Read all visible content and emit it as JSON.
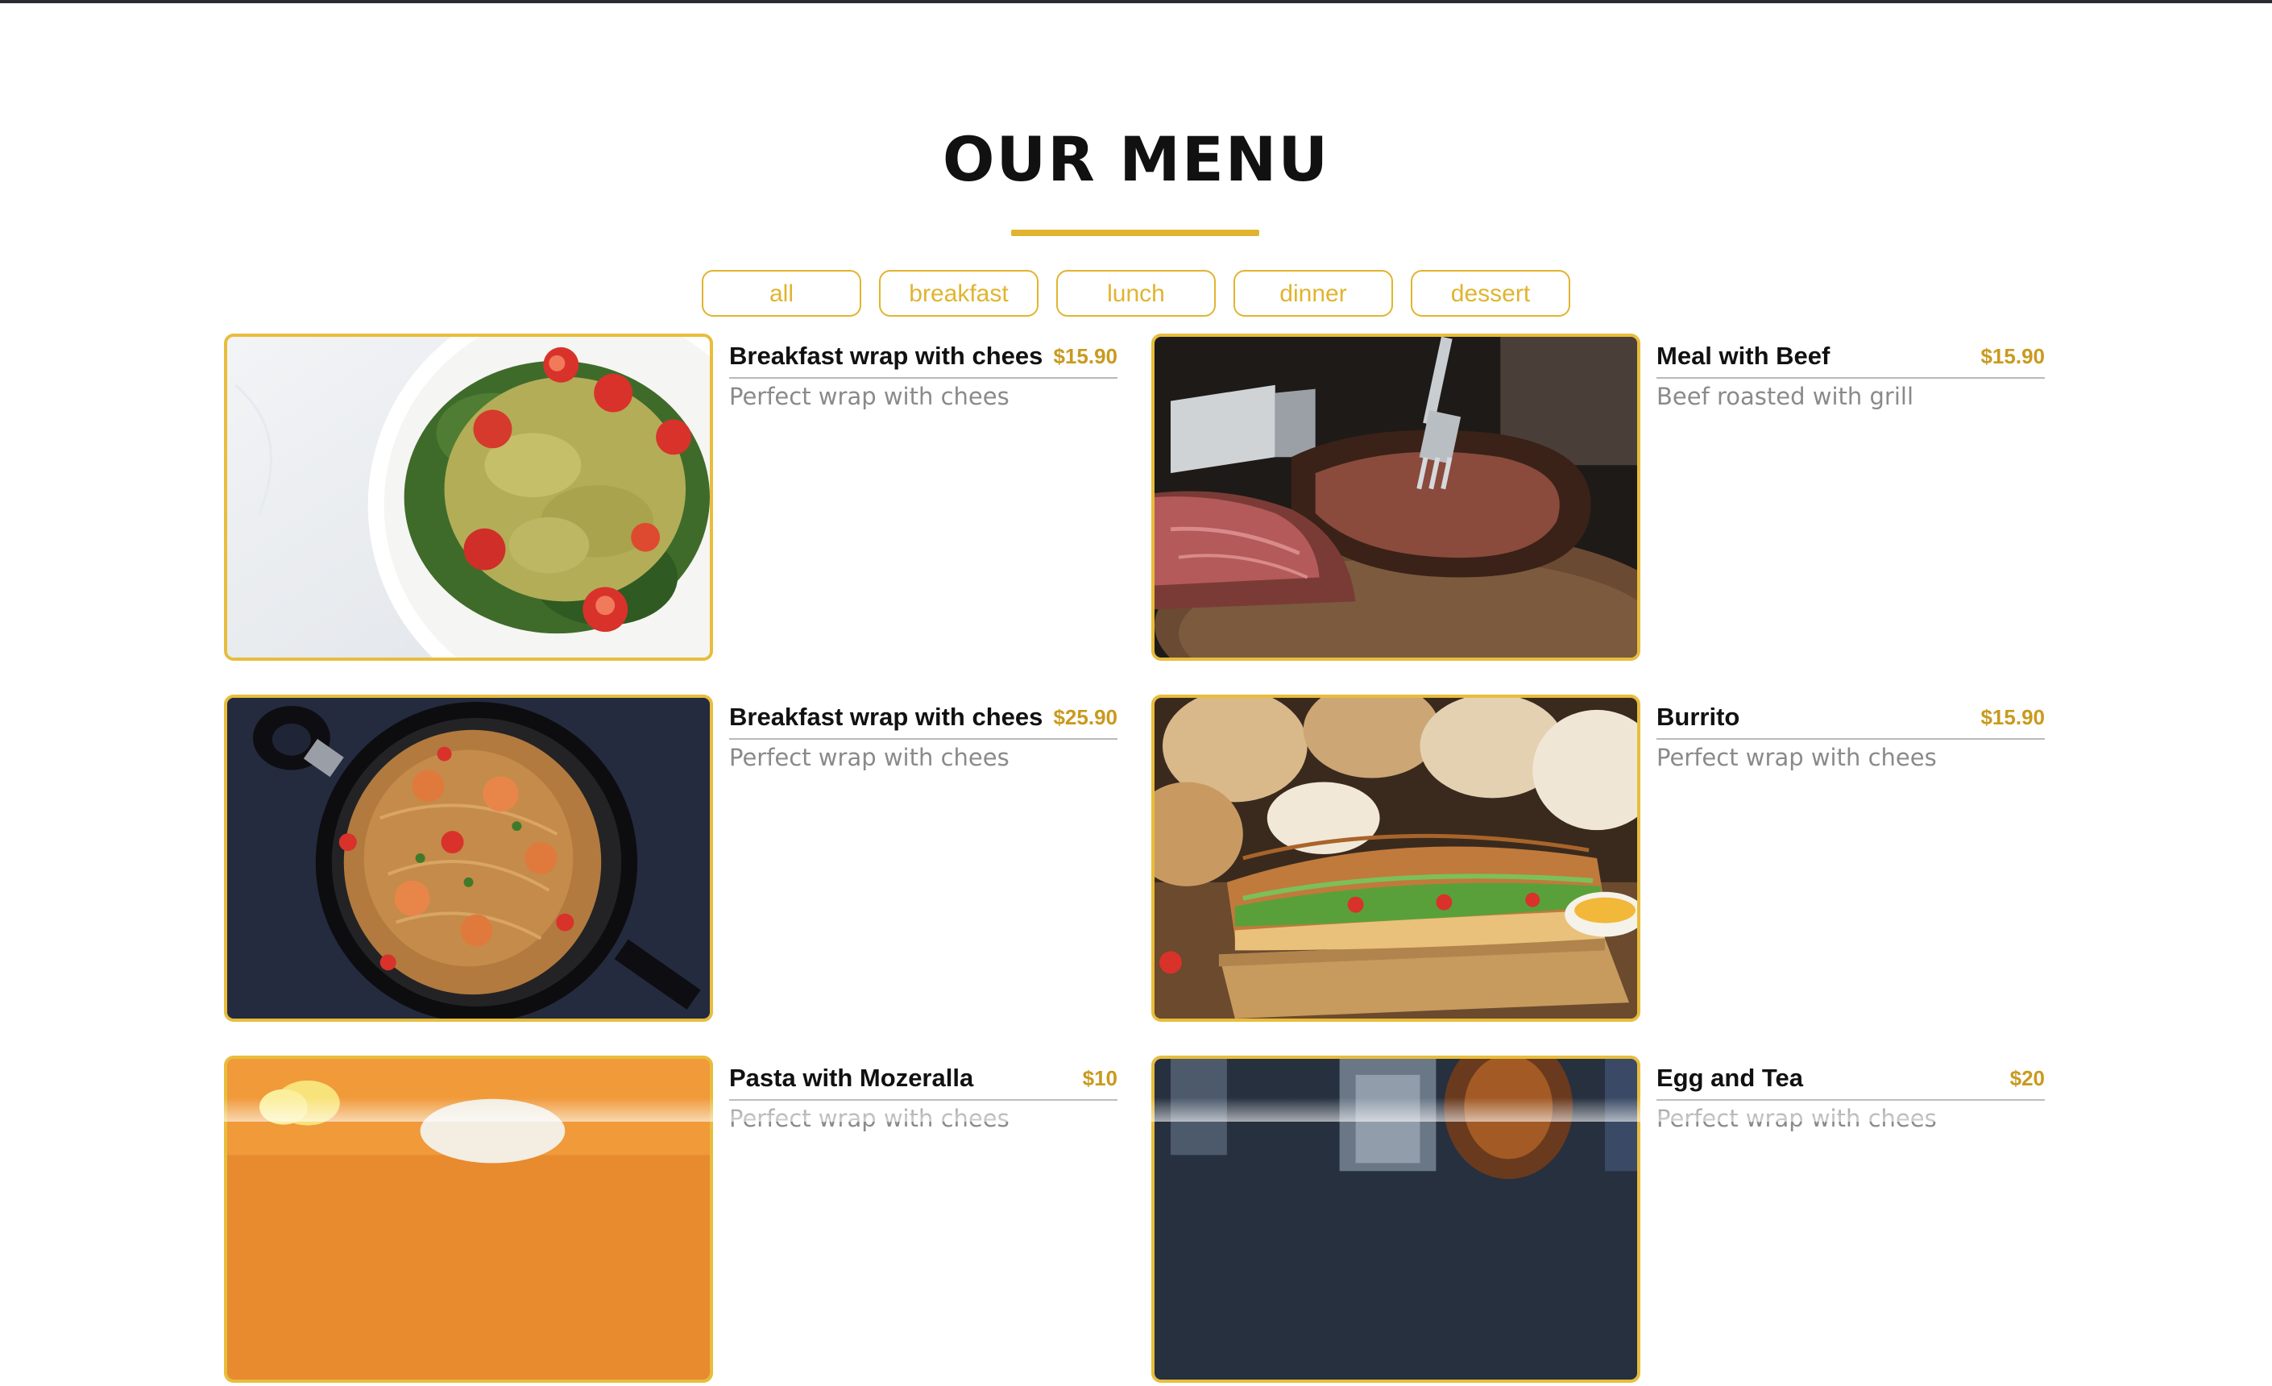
{
  "section": {
    "title": "OUR MENU"
  },
  "filters": [
    {
      "label": "all"
    },
    {
      "label": "breakfast"
    },
    {
      "label": "lunch"
    },
    {
      "label": "dinner"
    },
    {
      "label": "dessert"
    }
  ],
  "colors": {
    "accent": "#e1b42f",
    "price": "#c99a1e",
    "description": "#8a8a8a",
    "title": "#111111"
  },
  "menu_items": [
    {
      "name": "Breakfast wrap with chees",
      "price": "$15.90",
      "description": "Perfect wrap with chees",
      "image": "pesto-farfalle-salad"
    },
    {
      "name": "Meal with Beef",
      "price": "$15.90",
      "description": "Beef roasted with grill",
      "image": "sliced-grilled-beef"
    },
    {
      "name": "Breakfast wrap with chees",
      "price": "$25.90",
      "description": "Perfect wrap with chees",
      "image": "shrimp-spaghetti-pan"
    },
    {
      "name": "Burrito",
      "price": "$15.90",
      "description": "Perfect wrap with chees",
      "image": "baguette-sandwich"
    },
    {
      "name": "Pasta with Mozeralla",
      "price": "$10",
      "description": "Perfect wrap with chees",
      "image": "orange-background-dish"
    },
    {
      "name": "Egg and Tea",
      "price": "$20",
      "description": "Perfect wrap with chees",
      "image": "glasses-and-tea"
    }
  ]
}
